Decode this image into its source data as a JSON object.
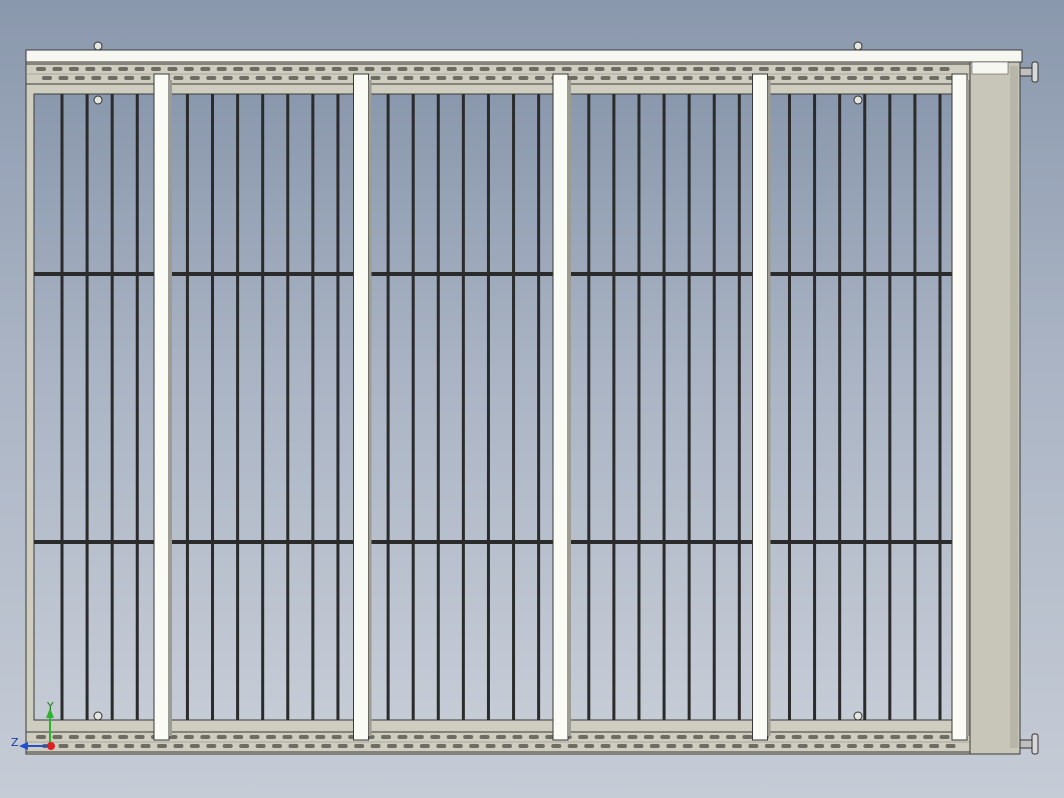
{
  "viewport": {
    "background_top": "#8a98ad",
    "background_bottom": "#c6ccd6"
  },
  "model": {
    "frame_color": "#cfcdc0",
    "frame_edge": "#3a3a3a",
    "bar_color": "#2b2b2b",
    "post_color": "#fbfbf5",
    "motor_color": "#c8c6b8",
    "top_cap_color": "#f7f7f2",
    "bar_count": 36,
    "post_count": 5,
    "rail_slot_count": 56
  },
  "triad": {
    "y_label": "Y",
    "z_label": "Z",
    "y_color": "#2db32d",
    "z_color": "#2050d0",
    "x_color": "#e02020"
  }
}
